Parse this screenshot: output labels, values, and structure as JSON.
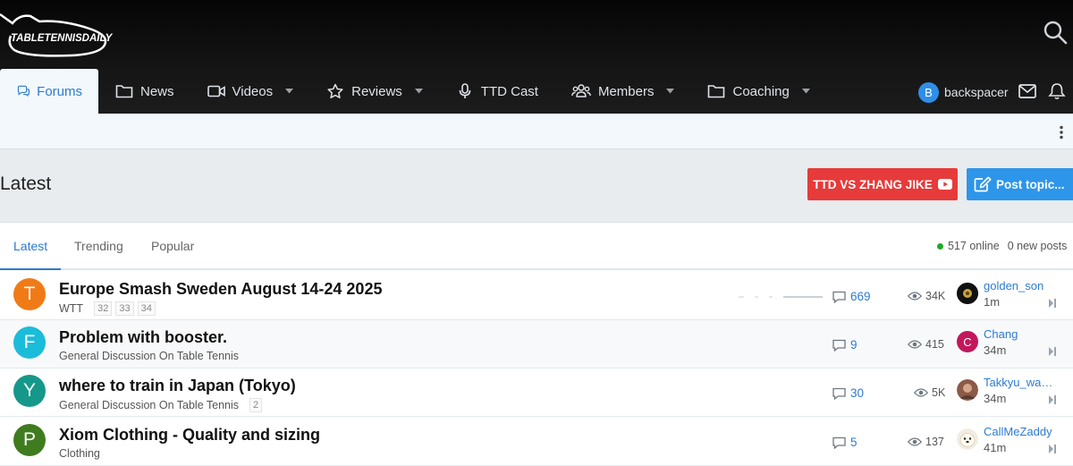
{
  "site": {
    "logo_text": "TABLETENNISDAILY"
  },
  "nav": {
    "items": [
      {
        "label": "Forums",
        "icon": "comments-icon",
        "active": true
      },
      {
        "label": "News",
        "icon": "folder-icon"
      },
      {
        "label": "Videos",
        "icon": "video-icon",
        "dropdown": true
      },
      {
        "label": "Reviews",
        "icon": "star-icon",
        "dropdown": true
      },
      {
        "label": "TTD Cast",
        "icon": "microphone-icon"
      },
      {
        "label": "Members",
        "icon": "users-icon",
        "dropdown": true
      },
      {
        "label": "Coaching",
        "icon": "folder-icon",
        "dropdown": true
      }
    ]
  },
  "user": {
    "initial": "B",
    "name": "backspacer"
  },
  "page": {
    "title": "Latest"
  },
  "buttons": {
    "promo": "TTD VS ZHANG JIKE",
    "post": "Post topic..."
  },
  "tabs": [
    "Latest",
    "Trending",
    "Popular"
  ],
  "status": {
    "online": "517 online",
    "new_posts": "0 new posts"
  },
  "colors": {
    "accent": "#2c7bd1",
    "promo": "#e73a3a",
    "post": "#2d96ea",
    "online": "#21a829"
  },
  "threads": [
    {
      "initial": "T",
      "avatar_color": "#f07b16",
      "title": "Europe Smash Sweden August 14-24 2025",
      "forum": "WTT",
      "pages": [
        "32",
        "33",
        "34"
      ],
      "replies": "669",
      "views": "34K",
      "last_user": "golden_son",
      "last_time": "1m",
      "last_avatar": "dark-ball"
    },
    {
      "initial": "F",
      "avatar_color": "#1bbcd9",
      "title": "Problem with booster.",
      "forum": "General Discussion On Table Tennis",
      "pages": [],
      "replies": "9",
      "views": "415",
      "last_user": "Chang",
      "last_time": "34m",
      "last_avatar": "C",
      "last_avatar_color": "#c2185b"
    },
    {
      "initial": "Y",
      "avatar_color": "#15988a",
      "title": "where to train in Japan (Tokyo)",
      "forum": "General Discussion On Table Tennis",
      "pages": [
        "2"
      ],
      "replies": "30",
      "views": "5K",
      "last_user": "Takkyu_wa_i...",
      "last_time": "34m",
      "last_avatar": "photo"
    },
    {
      "initial": "P",
      "avatar_color": "#3f7c1f",
      "title": "Xiom Clothing - Quality and sizing",
      "forum": "Clothing",
      "pages": [],
      "replies": "5",
      "views": "137",
      "last_user": "CallMeZaddy",
      "last_time": "41m",
      "last_avatar": "dog"
    }
  ]
}
